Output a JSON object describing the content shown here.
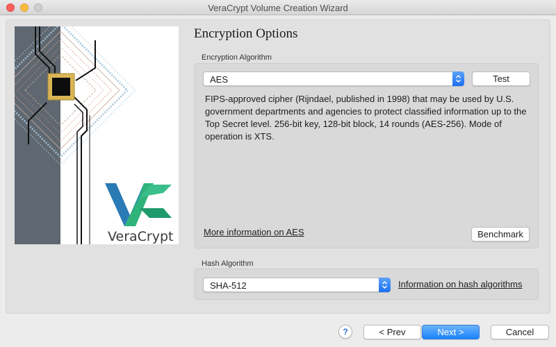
{
  "window": {
    "title": "VeraCrypt Volume Creation Wizard"
  },
  "page": {
    "title": "Encryption Options"
  },
  "art": {
    "brand_text": "VeraCrypt",
    "accent_green": "#2fb37a",
    "accent_blue": "#2a7bb5"
  },
  "encryption": {
    "group_label": "Encryption Algorithm",
    "selected_algorithm": "AES",
    "test_label": "Test",
    "description": "FIPS-approved cipher (Rijndael, published in 1998) that may be used by U.S. government departments and agencies to protect classified information up to the Top Secret level. 256-bit key, 128-bit block, 14 rounds (AES-256). Mode of operation is XTS.",
    "more_info_link": "More information on AES",
    "benchmark_label": "Benchmark"
  },
  "hash": {
    "group_label": "Hash Algorithm",
    "selected_algorithm": "SHA-512",
    "info_link": "Information on hash algorithms"
  },
  "footer": {
    "help_label": "?",
    "prev_label": "< Prev",
    "next_label": "Next >",
    "cancel_label": "Cancel"
  }
}
